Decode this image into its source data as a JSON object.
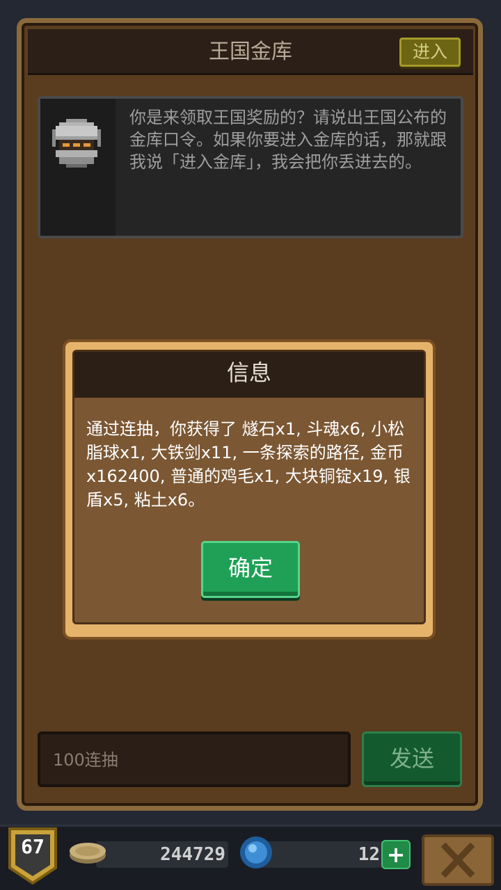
{
  "header": {
    "title": "王国金库",
    "enter_label": "进入"
  },
  "npc": {
    "avatar_icon": "knight-helmet-icon",
    "speech": "你是来领取王国奖励的？请说出王国公布的金库口令。如果你要进入金库的话，那就跟我说「进入金库」，我会把你丢进去的。"
  },
  "dialog": {
    "title": "信息",
    "message": "通过连抽，你获得了 燧石x1, 斗魂x6, 小松脂球x1, 大铁剑x11, 一条探索的路径, 金币x162400, 普通的鸡毛x1, 大块铜锭x19, 银盾x5, 粘土x6。",
    "ok_label": "确定"
  },
  "input": {
    "value": "100连抽",
    "send_label": "发送"
  },
  "status": {
    "level": "67",
    "coins": "244729",
    "gems": "12",
    "add_label": "+",
    "coin_icon": "coin-icon",
    "gem_icon": "blue-gem-icon",
    "close_icon": "close-icon"
  },
  "colors": {
    "panel": "#5a3d1f",
    "frame": "#8a6a3c",
    "dialog_border": "#e5b46a",
    "ok_green": "#1fa056",
    "send_green": "#135b2f"
  }
}
